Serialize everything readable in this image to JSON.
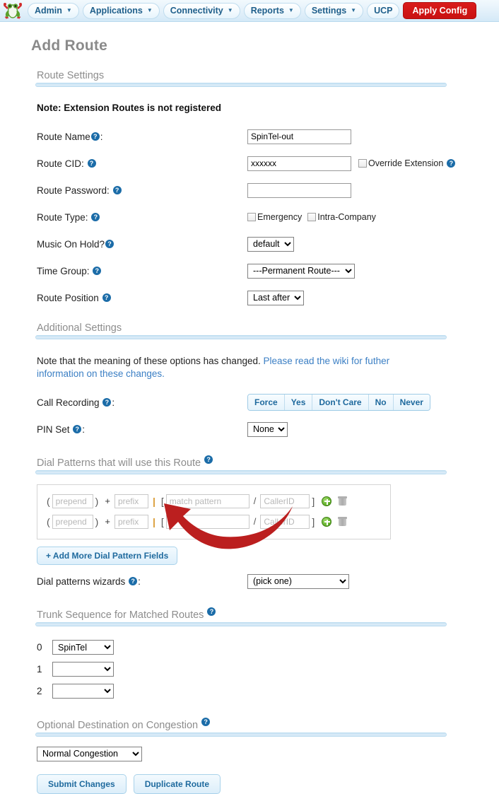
{
  "nav": {
    "logo_icon": "freepbx-frog-logo",
    "items": [
      {
        "label": "Admin",
        "has_caret": true
      },
      {
        "label": "Applications",
        "has_caret": true
      },
      {
        "label": "Connectivity",
        "has_caret": true
      },
      {
        "label": "Reports",
        "has_caret": true
      },
      {
        "label": "Settings",
        "has_caret": true
      },
      {
        "label": "UCP",
        "has_caret": false
      }
    ],
    "apply_label": "Apply Config",
    "apply_color": "#cc1111"
  },
  "page": {
    "title": "Add Route"
  },
  "sections": {
    "route_settings": "Route Settings",
    "additional_settings": "Additional Settings",
    "dial_patterns": "Dial Patterns that will use this Route",
    "trunk_sequence": "Trunk Sequence for Matched Routes",
    "optional_destination": "Optional Destination on Congestion"
  },
  "route_settings": {
    "note": "Note: Extension Routes is not registered",
    "route_name": {
      "label": "Route Name",
      "value": "SpinTel-out"
    },
    "route_cid": {
      "label": "Route CID:",
      "value": "xxxxxx",
      "override_label": "Override Extension",
      "override_checked": false
    },
    "route_password": {
      "label": "Route Password:",
      "value": "",
      "placeholder": ""
    },
    "route_type": {
      "label": "Route Type:",
      "emergency_label": "Emergency",
      "emergency_checked": false,
      "intra_label": "Intra-Company",
      "intra_checked": false
    },
    "music_on_hold": {
      "label": "Music On Hold?",
      "value": "default",
      "options": [
        "default"
      ]
    },
    "time_group": {
      "label": "Time Group:",
      "value": "---Permanent Route---",
      "options": [
        "---Permanent Route---"
      ]
    },
    "route_position": {
      "label": "Route Position",
      "value": "Last after",
      "options": [
        "Last after"
      ]
    }
  },
  "additional_settings": {
    "note_text": "Note that the meaning of these options has changed. ",
    "note_link": "Please read the wiki for futher information on these changes.",
    "call_recording": {
      "label": "Call Recording",
      "options": [
        "Force",
        "Yes",
        "Don't Care",
        "No",
        "Never"
      ],
      "selected": ""
    },
    "pin_set": {
      "label": "PIN Set",
      "value": "None",
      "options": [
        "None"
      ]
    }
  },
  "dial_patterns": {
    "rows": [
      {
        "prepend_placeholder": "prepend",
        "prepend_value": "",
        "prefix_placeholder": "prefix",
        "prefix_value": "",
        "match_placeholder": "match pattern",
        "match_value": "",
        "callerid_placeholder": "CallerID",
        "callerid_value": ""
      },
      {
        "prepend_placeholder": "prepend",
        "prepend_value": "",
        "prefix_placeholder": "prefix",
        "prefix_value": "",
        "match_placeholder": "",
        "match_value": ".",
        "callerid_placeholder": "CallerID",
        "callerid_value": ""
      }
    ],
    "symbols": {
      "open_paren": "(",
      "close_paren": ")",
      "plus": "+",
      "pipe": "|",
      "open_bracket": "[",
      "slash": "/",
      "close_bracket": "]"
    },
    "add_more_label": "+ Add More Dial Pattern Fields",
    "wizards": {
      "label": "Dial patterns wizards",
      "value": "(pick one)",
      "options": [
        "(pick one)"
      ]
    }
  },
  "trunk_sequence": {
    "rows": [
      {
        "index": "0",
        "value": "SpinTel",
        "options": [
          "SpinTel"
        ]
      },
      {
        "index": "1",
        "value": "",
        "options": [
          ""
        ]
      },
      {
        "index": "2",
        "value": "",
        "options": [
          ""
        ]
      }
    ]
  },
  "optional_destination": {
    "value": "Normal Congestion",
    "options": [
      "Normal Congestion"
    ]
  },
  "footer": {
    "submit_label": "Submit Changes",
    "duplicate_label": "Duplicate Route"
  },
  "annotation": {
    "arrow_icon": "red-curved-arrow",
    "arrow_color": "#bb1f1f",
    "points_at": "dial-pattern-match-input-row-2"
  },
  "icons": {
    "help": "?",
    "caret_down": "▼",
    "add": "add-circle-icon",
    "delete": "trash-icon"
  }
}
